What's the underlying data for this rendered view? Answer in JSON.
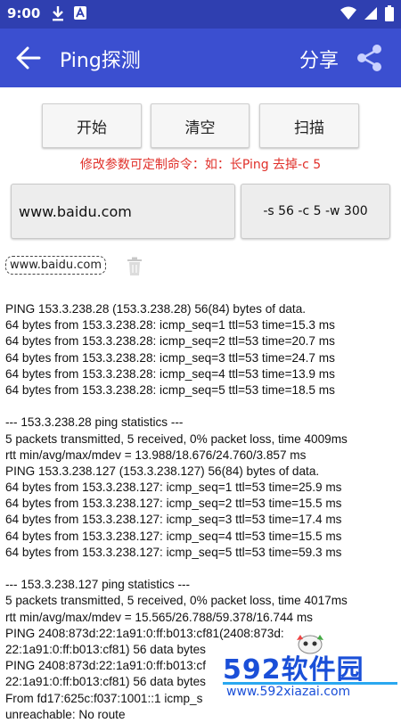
{
  "status_bar": {
    "time": "9:00",
    "left_icons": [
      "download-icon",
      "a-box-icon"
    ],
    "right_icons": [
      "wifi-icon",
      "signal-icon",
      "battery-icon"
    ],
    "color": "#2f3fb0"
  },
  "app_bar": {
    "title": "Ping探测",
    "share_label": "分享",
    "color": "#3b4fd0"
  },
  "actions": {
    "start": "开始",
    "clear": "清空",
    "scan": "扫描"
  },
  "hint": "修改参数可定制命令：如：长Ping 去掉-c 5",
  "hint_color": "#e0302a",
  "host_input": {
    "value": "www.baidu.com"
  },
  "param_input": {
    "value": "-s 56 -c 5 -w 300"
  },
  "history": {
    "chip": "www.baidu.com"
  },
  "output": [
    "PING 153.3.238.28 (153.3.238.28) 56(84) bytes of data.",
    "64 bytes from 153.3.238.28: icmp_seq=1 ttl=53 time=15.3 ms",
    "64 bytes from 153.3.238.28: icmp_seq=2 ttl=53 time=20.7 ms",
    "64 bytes from 153.3.238.28: icmp_seq=3 ttl=53 time=24.7 ms",
    "64 bytes from 153.3.238.28: icmp_seq=4 ttl=53 time=13.9 ms",
    "64 bytes from 153.3.238.28: icmp_seq=5 ttl=53 time=18.5 ms",
    "",
    "--- 153.3.238.28 ping statistics ---",
    "5 packets transmitted, 5 received, 0% packet loss, time 4009ms",
    "rtt min/avg/max/mdev = 13.988/18.676/24.760/3.857 ms",
    "PING 153.3.238.127 (153.3.238.127) 56(84) bytes of data.",
    "64 bytes from 153.3.238.127: icmp_seq=1 ttl=53 time=25.9 ms",
    "64 bytes from 153.3.238.127: icmp_seq=2 ttl=53 time=15.5 ms",
    "64 bytes from 153.3.238.127: icmp_seq=3 ttl=53 time=17.4 ms",
    "64 bytes from 153.3.238.127: icmp_seq=4 ttl=53 time=15.5 ms",
    "64 bytes from 153.3.238.127: icmp_seq=5 ttl=53 time=59.3 ms",
    "",
    "--- 153.3.238.127 ping statistics ---",
    "5 packets transmitted, 5 received, 0% packet loss, time 4017ms",
    "rtt min/avg/max/mdev = 15.565/26.788/59.378/16.744 ms",
    "PING 2408:873d:22:1a91:0:ff:b013:cf81(2408:873d:",
    "22:1a91:0:ff:b013:cf81) 56 data bytes",
    "PING 2408:873d:22:1a91:0:ff:b013:cf",
    "22:1a91:0:ff:b013:cf81) 56 data bytes",
    "From fd17:625c:f037:1001::1 icmp_s",
    "unreachable: No route"
  ],
  "watermark": {
    "brand": "592软件园",
    "url": "www.592xiazai.com",
    "color": "#1a4fd8"
  }
}
